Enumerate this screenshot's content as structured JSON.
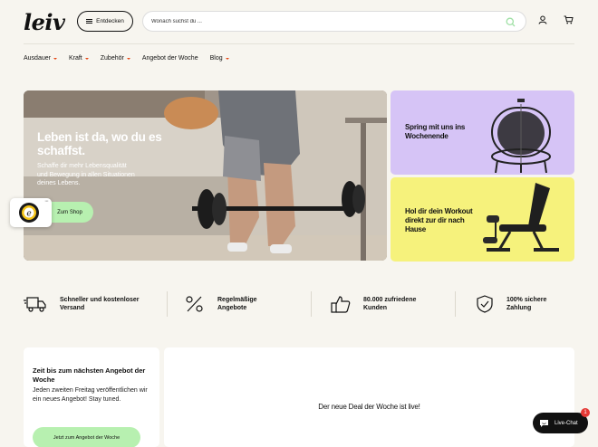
{
  "header": {
    "logo": "leiv",
    "discover_label": "Entdecken",
    "search_placeholder": "Wonach suchst du ..."
  },
  "nav": {
    "items": [
      {
        "label": "Ausdauer",
        "dropdown": true
      },
      {
        "label": "Kraft",
        "dropdown": true
      },
      {
        "label": "Zubehör",
        "dropdown": true
      },
      {
        "label": "Angebot der Woche",
        "dropdown": false
      },
      {
        "label": "Blog",
        "dropdown": true
      }
    ]
  },
  "hero": {
    "title": "Leben ist da, wo du es schaffst.",
    "text": "Schaffe dir mehr Lebensqualität und Bewegung in allen Situationen deines Lebens.",
    "cta": "Zum Shop"
  },
  "promos": [
    {
      "label": "Spring mit uns ins Wochenende",
      "bg": "#d6c4f6"
    },
    {
      "label": "Hol dir dein Workout direkt zur dir nach Hause",
      "bg": "#f6f27c"
    }
  ],
  "usps": [
    {
      "label": "Schneller und kostenloser Versand",
      "icon": "truck-icon"
    },
    {
      "label": "Regelmäßige Angebote",
      "icon": "percent-icon"
    },
    {
      "label": "80.000 zufriedene Kunden",
      "icon": "thumbs-up-icon"
    },
    {
      "label": "100% sichere Zahlung",
      "icon": "shield-check-icon"
    }
  ],
  "deal": {
    "title": "Zeit bis zum nächsten Angebot der Woche",
    "text": "Jeden zweiten Freitag veröffentlichen wir ein neues Angebot! Stay tuned.",
    "button": "Jetzt zum Angebot der Woche",
    "live_text": "Der neue Deal der Woche ist live!"
  },
  "chat": {
    "label": "Live-Chat",
    "badge": "1"
  },
  "colors": {
    "accent_green": "#b7f0b0",
    "promo_purple": "#d6c4f6",
    "promo_yellow": "#f6f27c",
    "nav_caret": "#e64a19",
    "background": "#f7f5ef"
  }
}
